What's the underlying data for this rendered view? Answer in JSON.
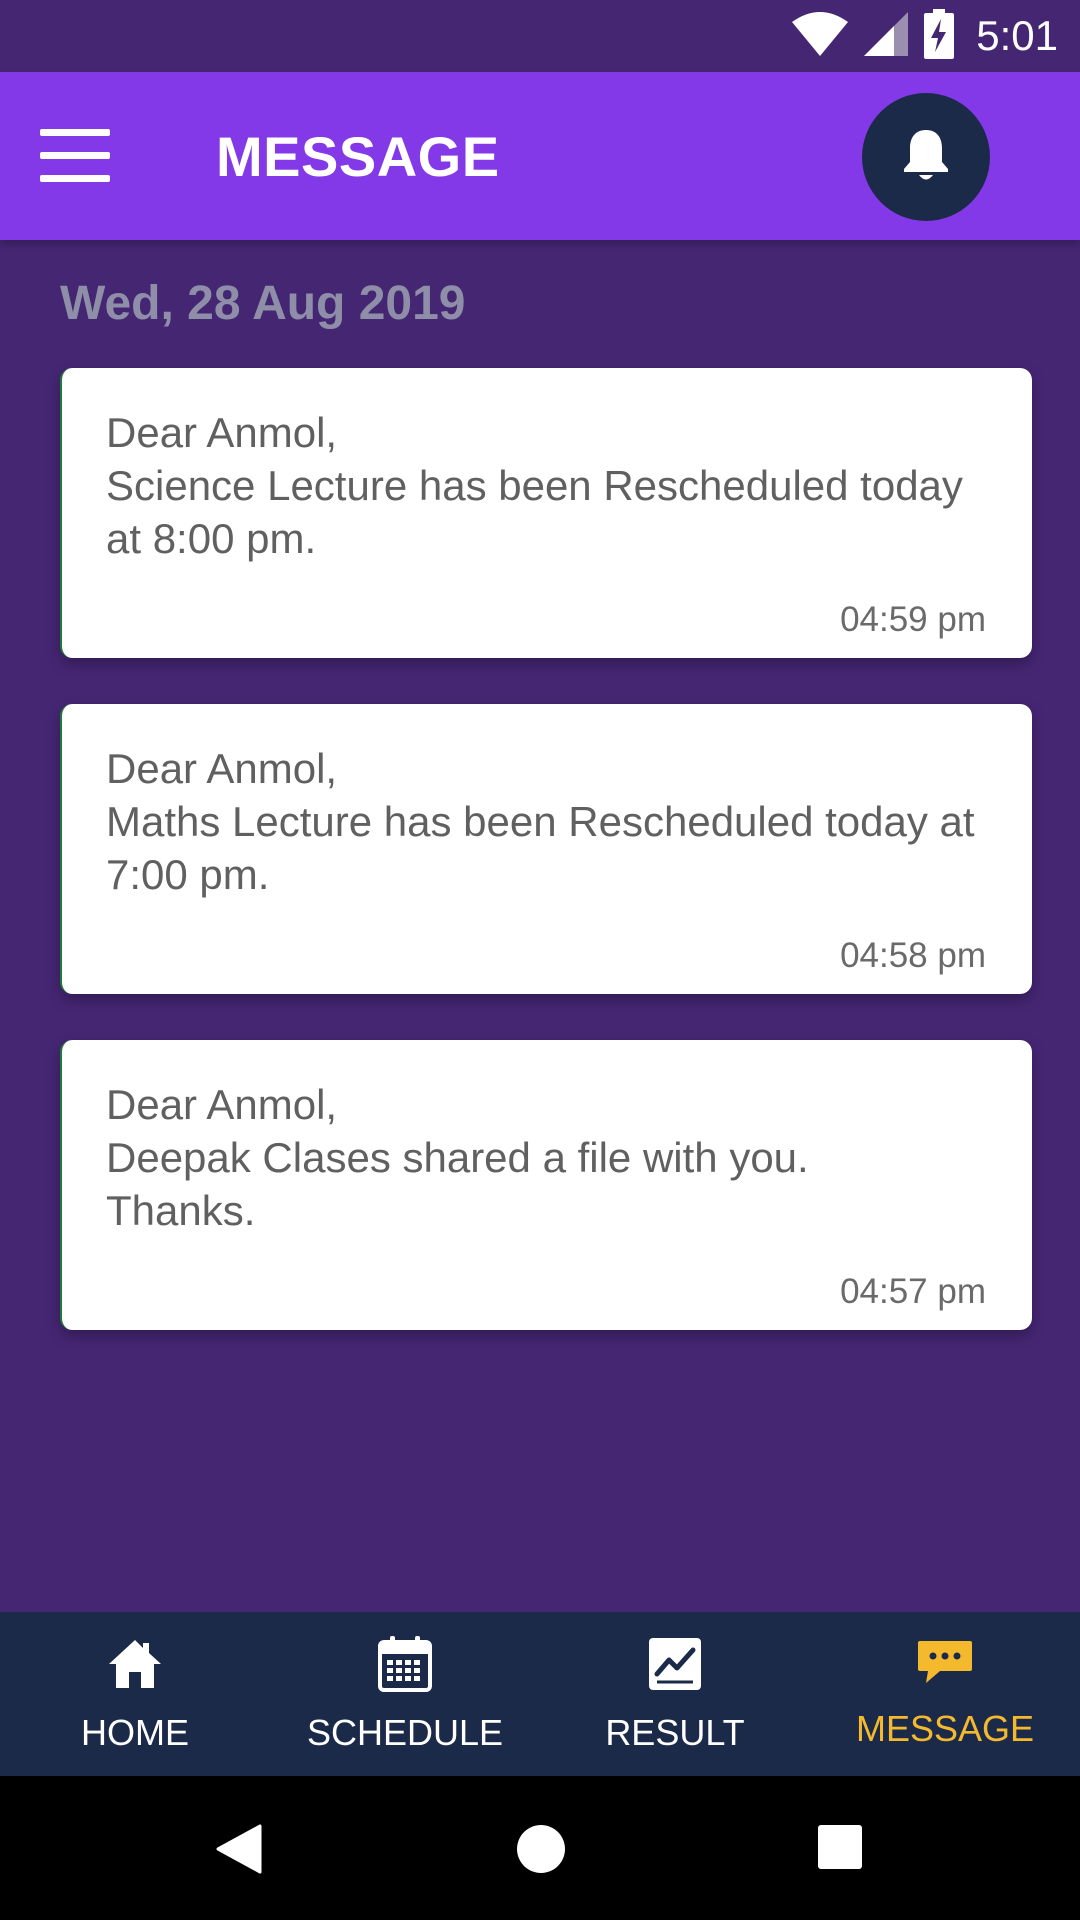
{
  "status_bar": {
    "time": "5:01",
    "icons": [
      "wifi-icon",
      "signal-icon",
      "battery-charging-icon"
    ]
  },
  "app_bar": {
    "title": "MESSAGE",
    "menu_icon": "hamburger-menu-icon",
    "notification_icon": "bell-icon"
  },
  "content": {
    "date_header": "Wed, 28 Aug 2019",
    "messages": [
      {
        "text": "Dear Anmol,\nScience Lecture has been Rescheduled today at 8:00 pm.",
        "time": "04:59 pm"
      },
      {
        "text": "Dear Anmol,\nMaths Lecture has been Rescheduled today at 7:00 pm.",
        "time": "04:58 pm"
      },
      {
        "text": "Dear Anmol,\nDeepak Clases shared a file with you.\nThanks.",
        "time": "04:57 pm"
      }
    ]
  },
  "bottom_nav": {
    "items": [
      {
        "label": "HOME",
        "icon": "home-icon"
      },
      {
        "label": "SCHEDULE",
        "icon": "calendar-icon"
      },
      {
        "label": "RESULT",
        "icon": "result-chart-icon"
      },
      {
        "label": "MESSAGE",
        "icon": "message-bubble-icon",
        "active": true
      }
    ]
  },
  "colors": {
    "background": "#452673",
    "app_bar": "#8439e8",
    "bottom_nav": "#1c2a4a",
    "active_tab": "#f4b92d"
  }
}
